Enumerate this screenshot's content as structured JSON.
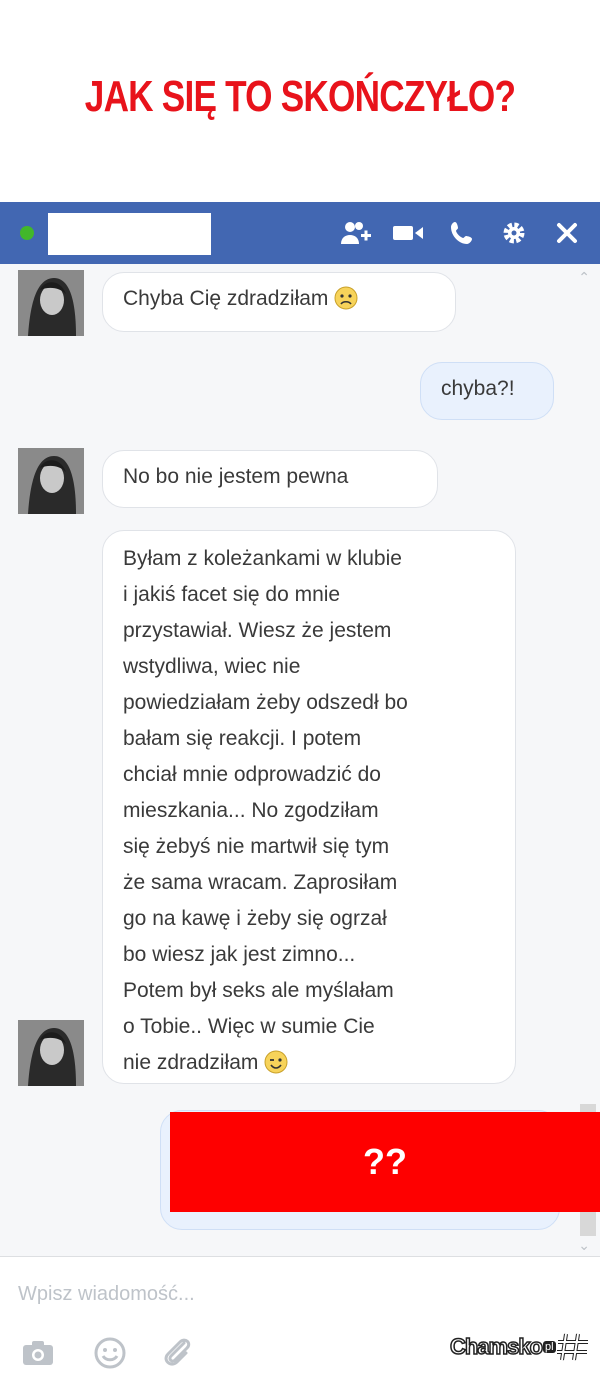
{
  "headline": "JAK SIĘ TO SKOŃCZYŁO?",
  "colors": {
    "headline": "#e8131b",
    "topbar": "#4267b2",
    "outgoing_bubble": "#e9f1fd",
    "red_box": "#fe0000",
    "online": "#42b72a"
  },
  "topbar_icons": [
    "add-people-icon",
    "video-call-icon",
    "phone-icon",
    "gear-icon",
    "close-icon"
  ],
  "messages": [
    {
      "from": "them",
      "text": "Chyba Cię zdradziłam",
      "emoji": "frown-emoji"
    },
    {
      "from": "me",
      "text": "chyba?!"
    },
    {
      "from": "them",
      "text": "No bo nie jestem pewna"
    },
    {
      "from": "them",
      "lines": [
        "Byłam z koleżankami w klubie",
        "i jakiś facet się do mnie",
        "przystawiał. Wiesz że jestem",
        "wstydliwa, wiec nie",
        "powiedziałam żeby odszedł bo",
        "bałam się reakcji. I potem",
        "chciał mnie odprowadzić do",
        "mieszkania... No zgodziłam",
        "się żebyś nie martwił się tym",
        "że sama wracam. Zaprosiłam",
        "go na kawę i żeby się ogrzał",
        "bo wiesz jak jest zimno...",
        "Potem był seks ale myślałam",
        "o Tobie.. Więc w sumie Cie",
        "nie zdradziłam"
      ],
      "emoji": "wink-emoji"
    }
  ],
  "hidden_reply": "??",
  "composer": {
    "placeholder": "Wpisz wiadomość..."
  },
  "composer_icons": [
    "camera-icon",
    "smiley-icon",
    "attachment-icon"
  ],
  "watermark": {
    "text": "Chamsko",
    "suffix": "pl"
  }
}
